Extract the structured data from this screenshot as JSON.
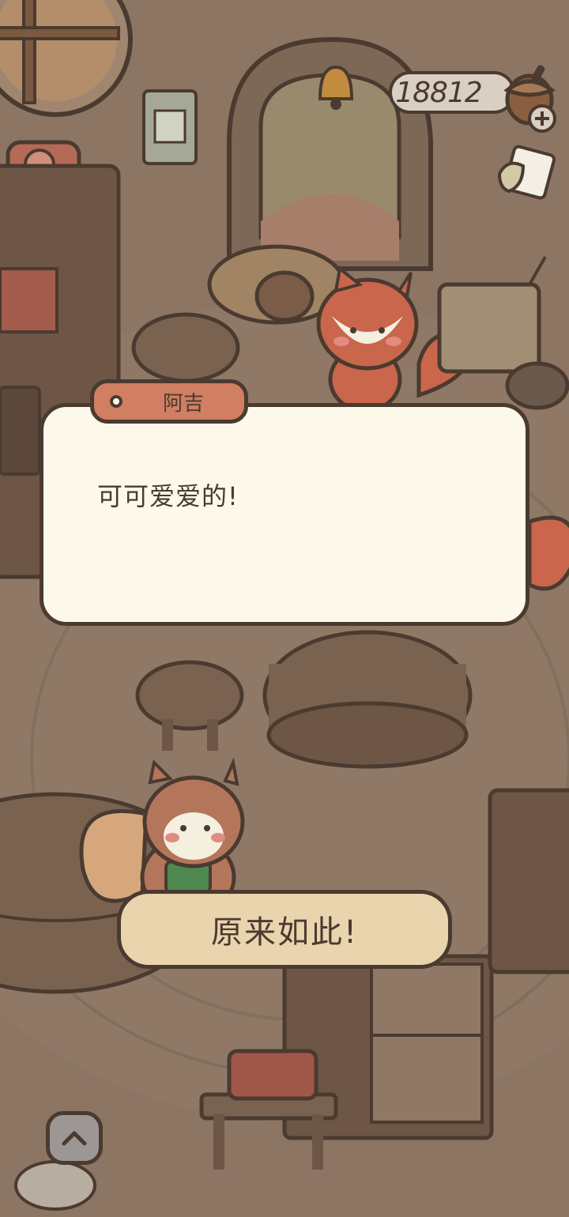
{
  "hud": {
    "currency_value": "18812",
    "currency_icon": "acorn-icon",
    "add_icon": "plus-icon",
    "memo_icon": "memo-icon"
  },
  "dialog": {
    "speaker": "阿吉",
    "text": "可可爱爱的!"
  },
  "choices": {
    "reply": "原来如此!"
  },
  "controls": {
    "expand_icon": "chevron-up-icon"
  },
  "colors": {
    "dialog_bg": "#fdf9ea",
    "name_tab": "#d17f63",
    "reply_bg": "#e9d4ae",
    "outline": "#4a3a30"
  }
}
